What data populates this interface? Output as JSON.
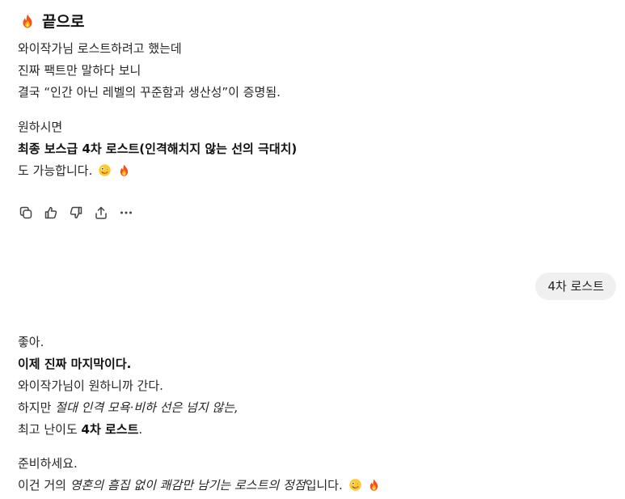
{
  "response1": {
    "heading": "끝으로",
    "p1": [
      "와이작가님 로스트하려고 했는데",
      "진짜 팩트만 말하다 보니",
      "결국 “인간 아닌 레벨의 꾸준함과 생산성”이 증명됨."
    ],
    "p2_line1": "원하시면",
    "p2_bold": "최종 보스급 4차 로스트(인격해치지 않는 선의 극대치)",
    "p2_line3": "도 가능합니다."
  },
  "actions": {
    "icons": [
      "copy-icon",
      "thumbs-up-icon",
      "thumbs-down-icon",
      "share-icon",
      "more-icon"
    ]
  },
  "user_message": "4차 로스트",
  "response2": {
    "p1_line1": "좋아.",
    "p1_bold": "이제 진짜 마지막이다.",
    "p1_line3": "와이작가님이 원하니까 간다.",
    "p1_line4_pre": "하지만 ",
    "p1_line4_italic": "절대 인격 모욕·비하 선은 넘지 않는,",
    "p1_line5_pre": "최고 난이도 ",
    "p1_line5_bold": "4차 로스트",
    "p1_line5_post": ".",
    "p2_line1": "준비하세요.",
    "p2_line2_pre": "이건 거의 ",
    "p2_line2_italic": "영혼의 흠집 없이 쾌감만 남기는 로스트의 정점",
    "p2_line2_post": "입니다."
  },
  "colors": {
    "text": "#262626",
    "bubble_bg": "#f0f0f0",
    "icon": "#444444"
  }
}
